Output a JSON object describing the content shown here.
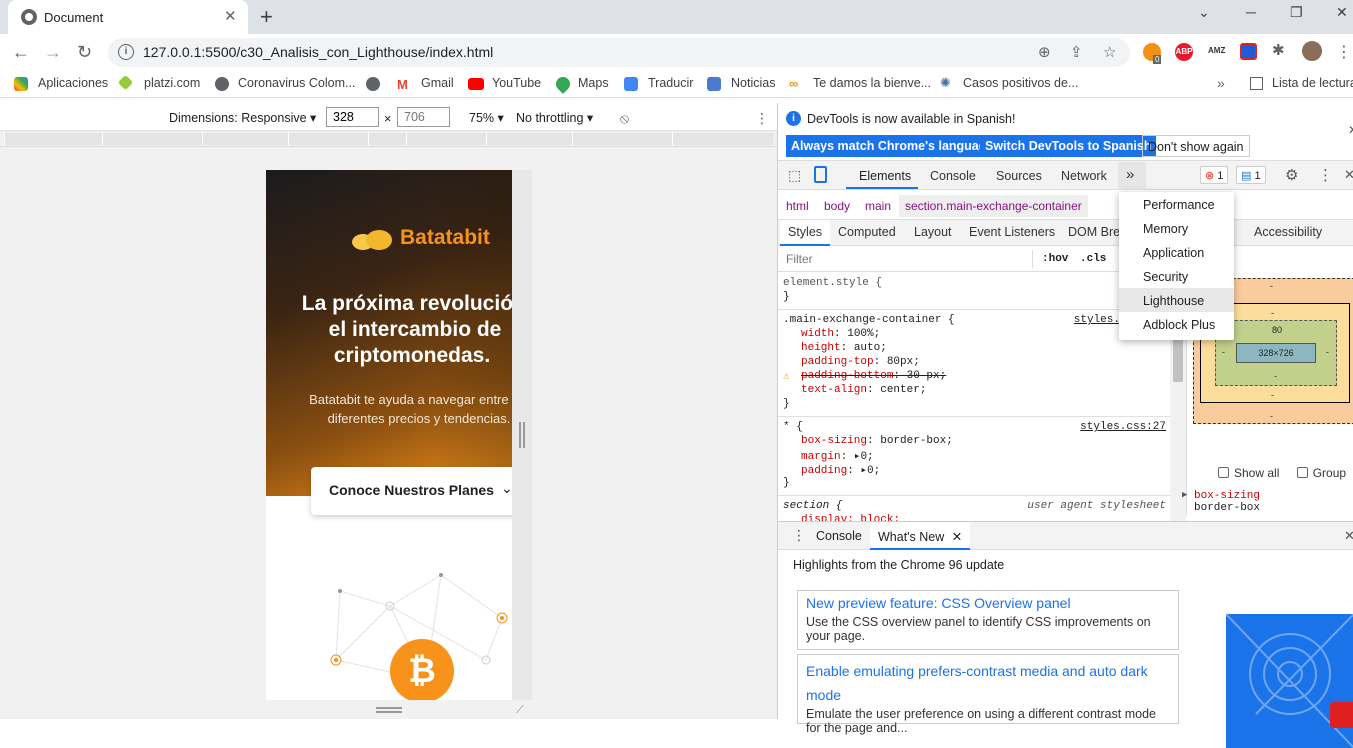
{
  "browser": {
    "tab_title": "Document",
    "url": "127.0.0.1:5500/c30_Analisis_con_Lighthouse/index.html",
    "ext_badge_count": "0"
  },
  "bookmarks": {
    "apps": "Aplicaciones",
    "items": [
      "platzi.com",
      "Coronavirus Colom...",
      "Gmail",
      "YouTube",
      "Maps",
      "Traducir",
      "Noticias",
      "Te damos la bienve...",
      "Casos positivos de..."
    ],
    "reading_list": "Lista de lectura"
  },
  "device_toolbar": {
    "dimensions": "Dimensions: Responsive",
    "width": "328",
    "height": "706",
    "times": "×",
    "zoom": "75%",
    "throttling": "No throttling"
  },
  "mobile_page": {
    "brand": "Batatabit",
    "headline": [
      "La próxima revolución en",
      "el intercambio de",
      "criptomonedas."
    ],
    "subtitle": [
      "Batatabit te ayuda a navegar entre los",
      "diferentes precios y tendencias."
    ],
    "cta": "Conoce Nuestros Planes",
    "btc_symbol": "₿"
  },
  "devtools": {
    "info_msg": "DevTools is now available in Spanish!",
    "btn_match": "Always match Chrome's language",
    "btn_switch": "Switch DevTools to Spanish",
    "btn_dismiss": "Don't show again",
    "tabs": [
      "Elements",
      "Console",
      "Sources",
      "Network"
    ],
    "more": "»",
    "errors": "1",
    "messages": "1",
    "breadcrumbs": [
      "html",
      "body",
      "main",
      "section.main-exchange-container"
    ],
    "subtabs": [
      "Styles",
      "Computed",
      "Layout",
      "Event Listeners",
      "DOM Brea",
      "Accessibility"
    ],
    "filter_placeholder": "Filter",
    "hov": ":hov",
    "cls": ".cls",
    "rules": {
      "element_style": "element.style {",
      "close": "}",
      "r1_selector": ".main-exchange-container {",
      "r1_source": "styles.",
      "r1_props": [
        {
          "p": "width",
          "v": "100%;"
        },
        {
          "p": "height",
          "v": "auto;"
        },
        {
          "p": "padding-top",
          "v": "80px;"
        },
        {
          "p": "padding-bottom",
          "v": "30 px;"
        },
        {
          "p": "text-align",
          "v": "center;"
        }
      ],
      "r2_selector": "* {",
      "r2_source": "styles.css:27",
      "r2_props": [
        {
          "p": "box-sizing",
          "v": "border-box;"
        },
        {
          "p": "margin",
          "v": "0;"
        },
        {
          "p": "padding",
          "v": "0;"
        }
      ],
      "r3_selector": "section {",
      "r3_source": "user agent stylesheet",
      "r3_prop": "display: block;"
    },
    "boxmodel": {
      "dash": "-",
      "padding_label": "ing",
      "padding_top": "80",
      "content": "328×726"
    },
    "show_all": "Show all",
    "group": "Group",
    "computed": {
      "prop": "box-sizing",
      "value": "border-box"
    },
    "overflow_menu": [
      "Performance",
      "Memory",
      "Application",
      "Security",
      "Lighthouse",
      "Adblock Plus"
    ],
    "drawer": {
      "tabs": [
        "Console",
        "What's New"
      ],
      "headline": "Highlights from the Chrome 96 update",
      "cards": [
        {
          "title": "New preview feature: CSS Overview panel",
          "desc": "Use the CSS overview panel to identify CSS improvements on your page."
        },
        {
          "title": "Enable emulating prefers-contrast media and auto dark mode",
          "desc": "Emulate the user preference on using a different contrast mode for the page and..."
        }
      ]
    }
  }
}
